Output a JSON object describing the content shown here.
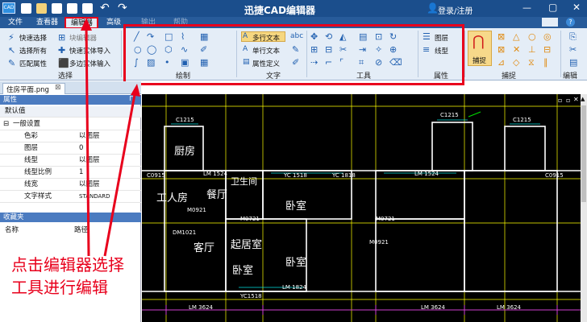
{
  "title_bar": {
    "app_title": "迅捷CAD编辑器",
    "login_label": "登录/注册",
    "app_logo": "CAD"
  },
  "menu_tabs": [
    {
      "label": "文件"
    },
    {
      "label": "查看器"
    },
    {
      "label": "编辑器"
    },
    {
      "label": "高级"
    },
    {
      "label": "输出"
    },
    {
      "label": "帮助"
    }
  ],
  "ribbon": {
    "select_group": {
      "label": "选择",
      "items": [
        "快速选择",
        "选择所有",
        "匹配属性"
      ]
    },
    "block_group": {
      "items": [
        "块编辑器",
        "快速实体导入",
        "多边实体输入"
      ]
    },
    "draw_group": {
      "label": "绘制"
    },
    "text_group": {
      "label": "文字",
      "items": [
        "多行文本",
        "单行文本",
        "属性定义"
      ]
    },
    "tools_group": {
      "label": "工具"
    },
    "attr_group": {
      "label": "属性",
      "items": [
        "图层",
        "线型"
      ]
    },
    "capture_group": {
      "label": "捕捉",
      "button": "捕捉"
    },
    "edit_group": {
      "label": "编辑"
    }
  },
  "drawing_tab": {
    "label": "住房平面.png"
  },
  "properties_panel": {
    "header": "属性",
    "default_value": "默认值",
    "section": "一般设置",
    "rows": [
      {
        "key": "色彩",
        "value": "以图层"
      },
      {
        "key": "图层",
        "value": "0"
      },
      {
        "key": "线型",
        "value": "以图层"
      },
      {
        "key": "线型比例",
        "value": "1"
      },
      {
        "key": "线宽",
        "value": "以图层"
      },
      {
        "key": "文字样式",
        "value": "STANDARD"
      }
    ]
  },
  "favorites_panel": {
    "header": "收藏夹",
    "col_name": "名称",
    "col_path": "路径"
  },
  "annotation": {
    "line1": "点击编辑器选择",
    "line2": "工具进行编辑"
  },
  "floor_plan_labels": [
    {
      "text": "厨房"
    },
    {
      "text": "餐厅"
    },
    {
      "text": "工人房"
    },
    {
      "text": "客厅"
    },
    {
      "text": "卫生间"
    },
    {
      "text": "卧室"
    },
    {
      "text": "起居室"
    },
    {
      "text": "卧室"
    },
    {
      "text": "卧室"
    }
  ],
  "drawing_codes": [
    "C1215",
    "C1215",
    "C1215",
    "C0915",
    "LM 1524",
    "YC 1518",
    "YC 1818",
    "LM 1524",
    "C0915",
    "M0921",
    "M0721",
    "M0721",
    "DM1021",
    "M0921",
    "LM 1824",
    "YC1518",
    "LM 3624",
    "LM 3624",
    "LM 3624"
  ],
  "colors": {
    "title_bar": "#1b4e8c",
    "ribbon_bg": "#e4edf7",
    "highlight_red": "#e8001c",
    "drawing_bg": "#000000",
    "wall_line": "#ffffff",
    "grid_yellow": "#ffff00",
    "dim_magenta": "#d040d0"
  }
}
